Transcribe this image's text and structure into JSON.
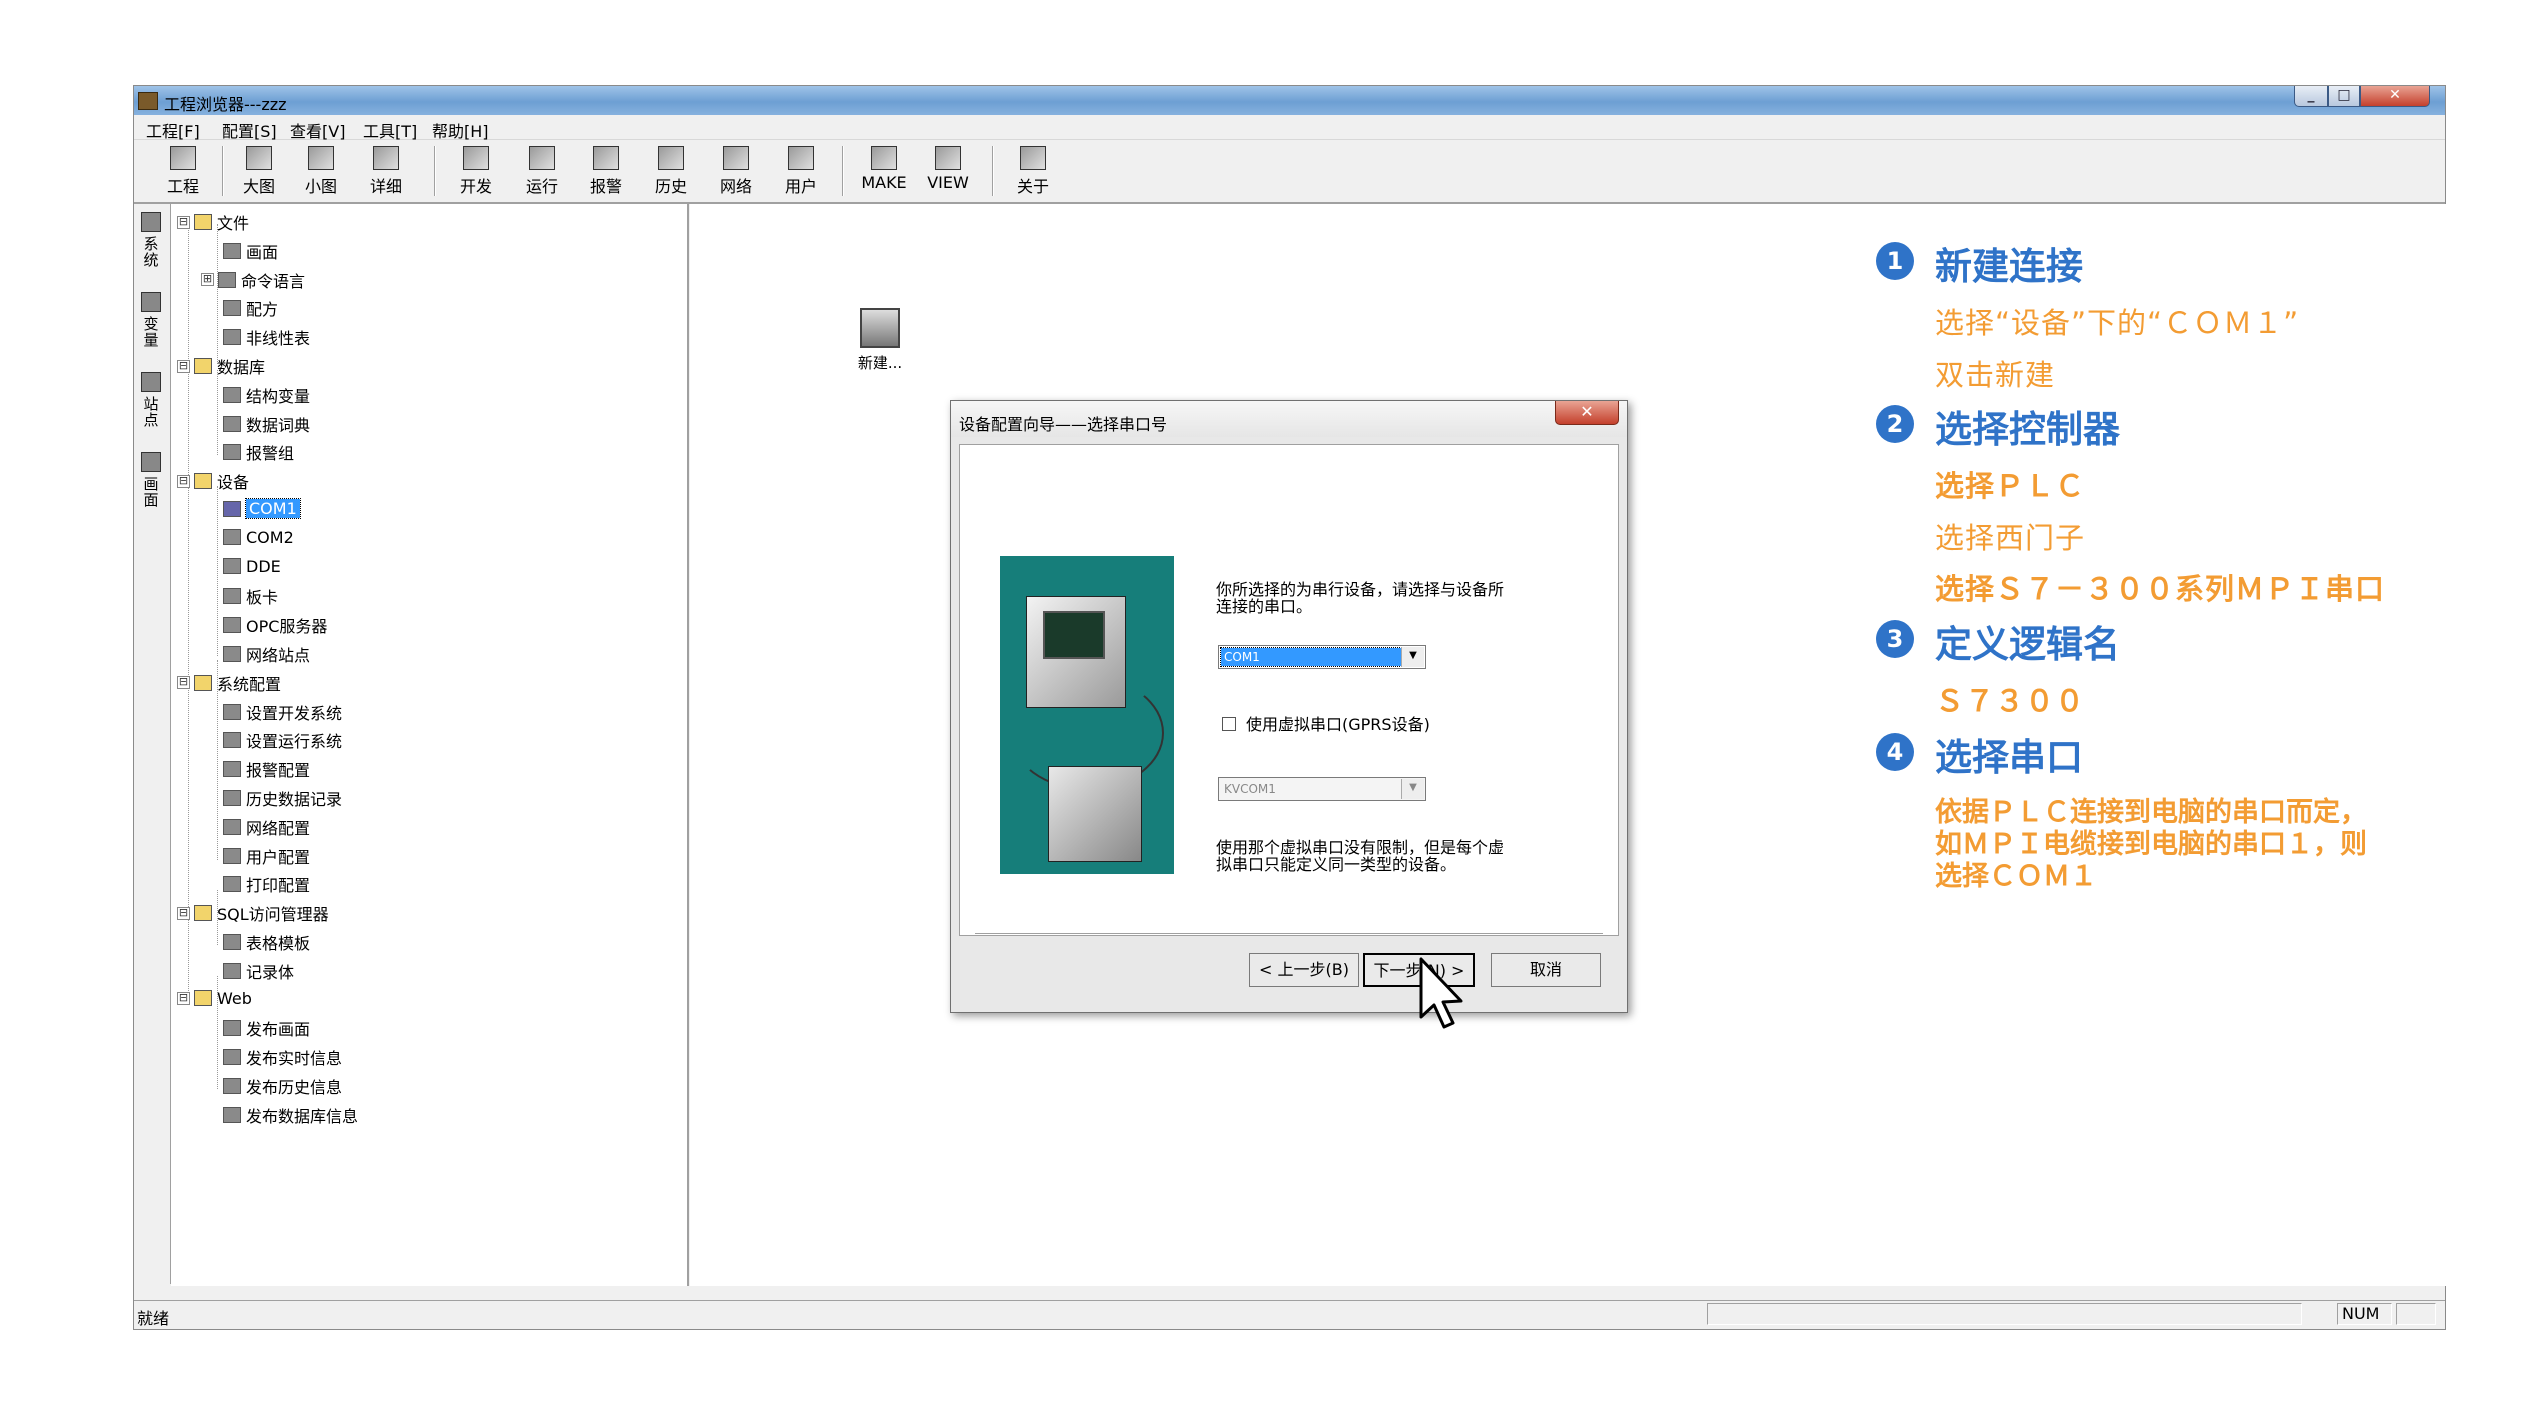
{
  "window": {
    "title": "工程浏览器---zzz",
    "min_glyph": "_",
    "max_glyph": "□",
    "close_glyph": "✕"
  },
  "menu": [
    "工程[F]",
    "配置[S]",
    "查看[V]",
    "工具[T]",
    "帮助[H]"
  ],
  "toolbar": [
    "工程",
    "大图",
    "小图",
    "详细",
    "开发",
    "运行",
    "报警",
    "历史",
    "网络",
    "用户",
    "MAKE",
    "VIEW",
    "关于"
  ],
  "vtabs": [
    "系统",
    "变量",
    "站点",
    "画面"
  ],
  "tree": [
    {
      "label": "文件",
      "level": 0,
      "exp": "⊟"
    },
    {
      "label": "画面",
      "level": 1
    },
    {
      "label": "命令语言",
      "level": 1,
      "exp": "⊞"
    },
    {
      "label": "配方",
      "level": 1
    },
    {
      "label": "非线性表",
      "level": 1
    },
    {
      "label": "数据库",
      "level": 0,
      "exp": "⊟"
    },
    {
      "label": "结构变量",
      "level": 1
    },
    {
      "label": "数据词典",
      "level": 1
    },
    {
      "label": "报警组",
      "level": 1
    },
    {
      "label": "设备",
      "level": 0,
      "exp": "⊟"
    },
    {
      "label": "COM1",
      "level": 1,
      "selected": true
    },
    {
      "label": "COM2",
      "level": 1
    },
    {
      "label": "DDE",
      "level": 1
    },
    {
      "label": "板卡",
      "level": 1
    },
    {
      "label": "OPC服务器",
      "level": 1
    },
    {
      "label": "网络站点",
      "level": 1
    },
    {
      "label": "系统配置",
      "level": 0,
      "exp": "⊟"
    },
    {
      "label": "设置开发系统",
      "level": 1
    },
    {
      "label": "设置运行系统",
      "level": 1
    },
    {
      "label": "报警配置",
      "level": 1
    },
    {
      "label": "历史数据记录",
      "level": 1
    },
    {
      "label": "网络配置",
      "level": 1
    },
    {
      "label": "用户配置",
      "level": 1
    },
    {
      "label": "打印配置",
      "level": 1
    },
    {
      "label": "SQL访问管理器",
      "level": 0,
      "exp": "⊟"
    },
    {
      "label": "表格模板",
      "level": 1
    },
    {
      "label": "记录体",
      "level": 1
    },
    {
      "label": "Web",
      "level": 0,
      "exp": "⊟"
    },
    {
      "label": "发布画面",
      "level": 1
    },
    {
      "label": "发布实时信息",
      "level": 1
    },
    {
      "label": "发布历史信息",
      "level": 1
    },
    {
      "label": "发布数据库信息",
      "level": 1
    }
  ],
  "main": {
    "new_item_label": "新建..."
  },
  "status": {
    "left": "就绪",
    "num": "NUM"
  },
  "dialog": {
    "title": "设备配置向导——选择串口号",
    "close_glyph": "✕",
    "text1": "你所选择的为串行设备，请选择与设备所连接的串口。",
    "com_value": "COM1",
    "dropdown_glyph": "▼",
    "checkbox_label": "使用虚拟串口(GPRS设备)",
    "virtual_value": "KVCOM1",
    "text2": "使用那个虚拟串口没有限制，但是每个虚拟串口只能定义同一类型的设备。",
    "btn_back": "< 上一步(B)",
    "btn_next": "下一步(N) >",
    "btn_cancel": "取消"
  },
  "annotations": {
    "colors": {
      "heading": "#2f73c8",
      "note": "#f39c33"
    },
    "steps": [
      {
        "num": "1",
        "title": "新建连接",
        "lines": [
          {
            "text": "选择“设备”下的“ＣＯＭ１”",
            "bold": false
          },
          {
            "text": "双击新建",
            "bold": false
          }
        ]
      },
      {
        "num": "2",
        "title": "选择控制器",
        "lines": [
          {
            "text": "选择ＰＬＣ",
            "bold": true
          },
          {
            "text": "选择西门子",
            "bold": false
          },
          {
            "text": "选择Ｓ７－３００系列ＭＰＩ串口",
            "bold": true
          }
        ]
      },
      {
        "num": "3",
        "title": "定义逻辑名",
        "lines": [
          {
            "text": "Ｓ７３００",
            "bold": true
          }
        ]
      },
      {
        "num": "4",
        "title": "选择串口",
        "lines": [
          {
            "text": "依据ＰＬＣ连接到电脑的串口而定，",
            "bold": true
          },
          {
            "text": "如ＭＰＩ电缆接到电脑的串口１，则",
            "bold": true
          },
          {
            "text": "选择ＣＯＭ１",
            "bold": true
          }
        ]
      }
    ]
  }
}
